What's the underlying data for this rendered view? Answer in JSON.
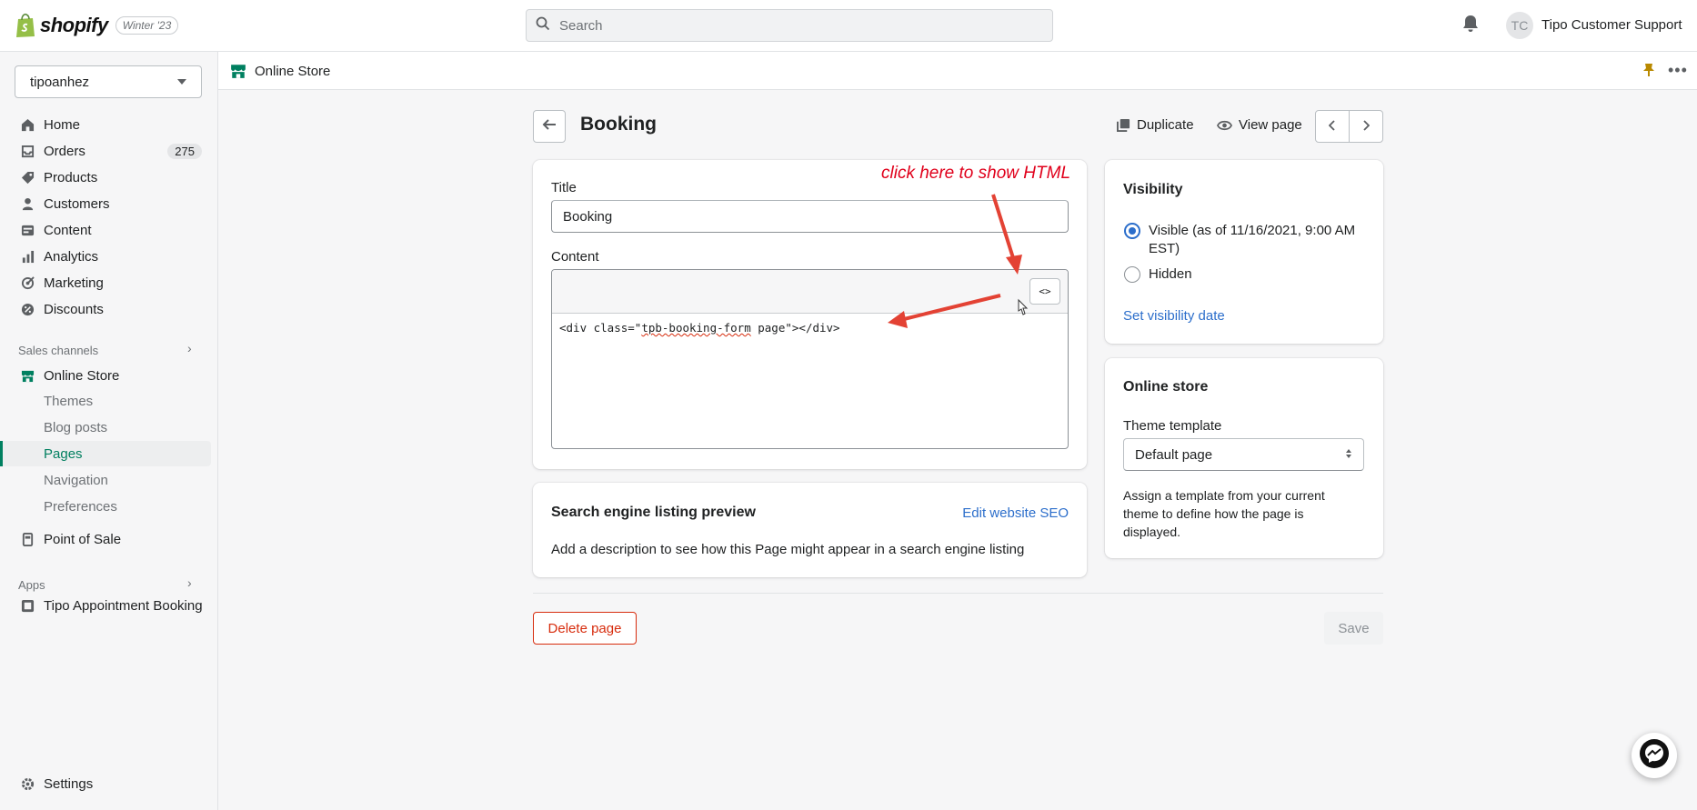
{
  "topbar": {
    "brand": "shopify",
    "edition_badge": "Winter '23",
    "search_placeholder": "Search",
    "user_initials": "TC",
    "user_name": "Tipo Customer Support"
  },
  "sidebar": {
    "store_name": "tipoanhez",
    "items": [
      {
        "label": "Home",
        "icon": "home-icon"
      },
      {
        "label": "Orders",
        "icon": "orders-icon",
        "count": "275"
      },
      {
        "label": "Products",
        "icon": "tag-icon"
      },
      {
        "label": "Customers",
        "icon": "person-icon"
      },
      {
        "label": "Content",
        "icon": "content-icon"
      },
      {
        "label": "Analytics",
        "icon": "analytics-icon"
      },
      {
        "label": "Marketing",
        "icon": "marketing-icon"
      },
      {
        "label": "Discounts",
        "icon": "discount-icon"
      }
    ],
    "sales_channels_label": "Sales channels",
    "online_store_label": "Online Store",
    "online_store_sub": [
      "Themes",
      "Blog posts",
      "Pages",
      "Navigation",
      "Preferences"
    ],
    "active_sub": "Pages",
    "point_of_sale_label": "Point of Sale",
    "apps_label": "Apps",
    "app_item": "Tipo Appointment Booking",
    "settings_label": "Settings"
  },
  "strip": {
    "title": "Online Store"
  },
  "page": {
    "title": "Booking",
    "duplicate_label": "Duplicate",
    "view_page_label": "View page",
    "delete_label": "Delete page",
    "save_label": "Save"
  },
  "editor_card": {
    "title_label": "Title",
    "title_value": "Booking",
    "content_label": "Content",
    "html_toggle": "<>",
    "code_prefix": "<div class=\"",
    "code_squiggle": "tpb-booking-form",
    "code_suffix": " page\"></div>",
    "annotation": "click here to show HTML"
  },
  "seo_card": {
    "heading": "Search engine listing preview",
    "edit_link": "Edit website SEO",
    "description": "Add a description to see how this Page might appear in a search engine listing"
  },
  "visibility_card": {
    "heading": "Visibility",
    "visible_label": "Visible (as of 11/16/2021, 9:00 AM EST)",
    "hidden_label": "Hidden",
    "selected": "visible",
    "set_date_link": "Set visibility date"
  },
  "online_store_card": {
    "heading": "Online store",
    "template_label": "Theme template",
    "template_value": "Default page",
    "help_text": "Assign a template from your current theme to define how the page is displayed."
  },
  "colors": {
    "accent_green": "#008060",
    "link_blue": "#2c6ecb",
    "critical_red": "#d72c0d",
    "annotation_red": "#e0001b"
  }
}
